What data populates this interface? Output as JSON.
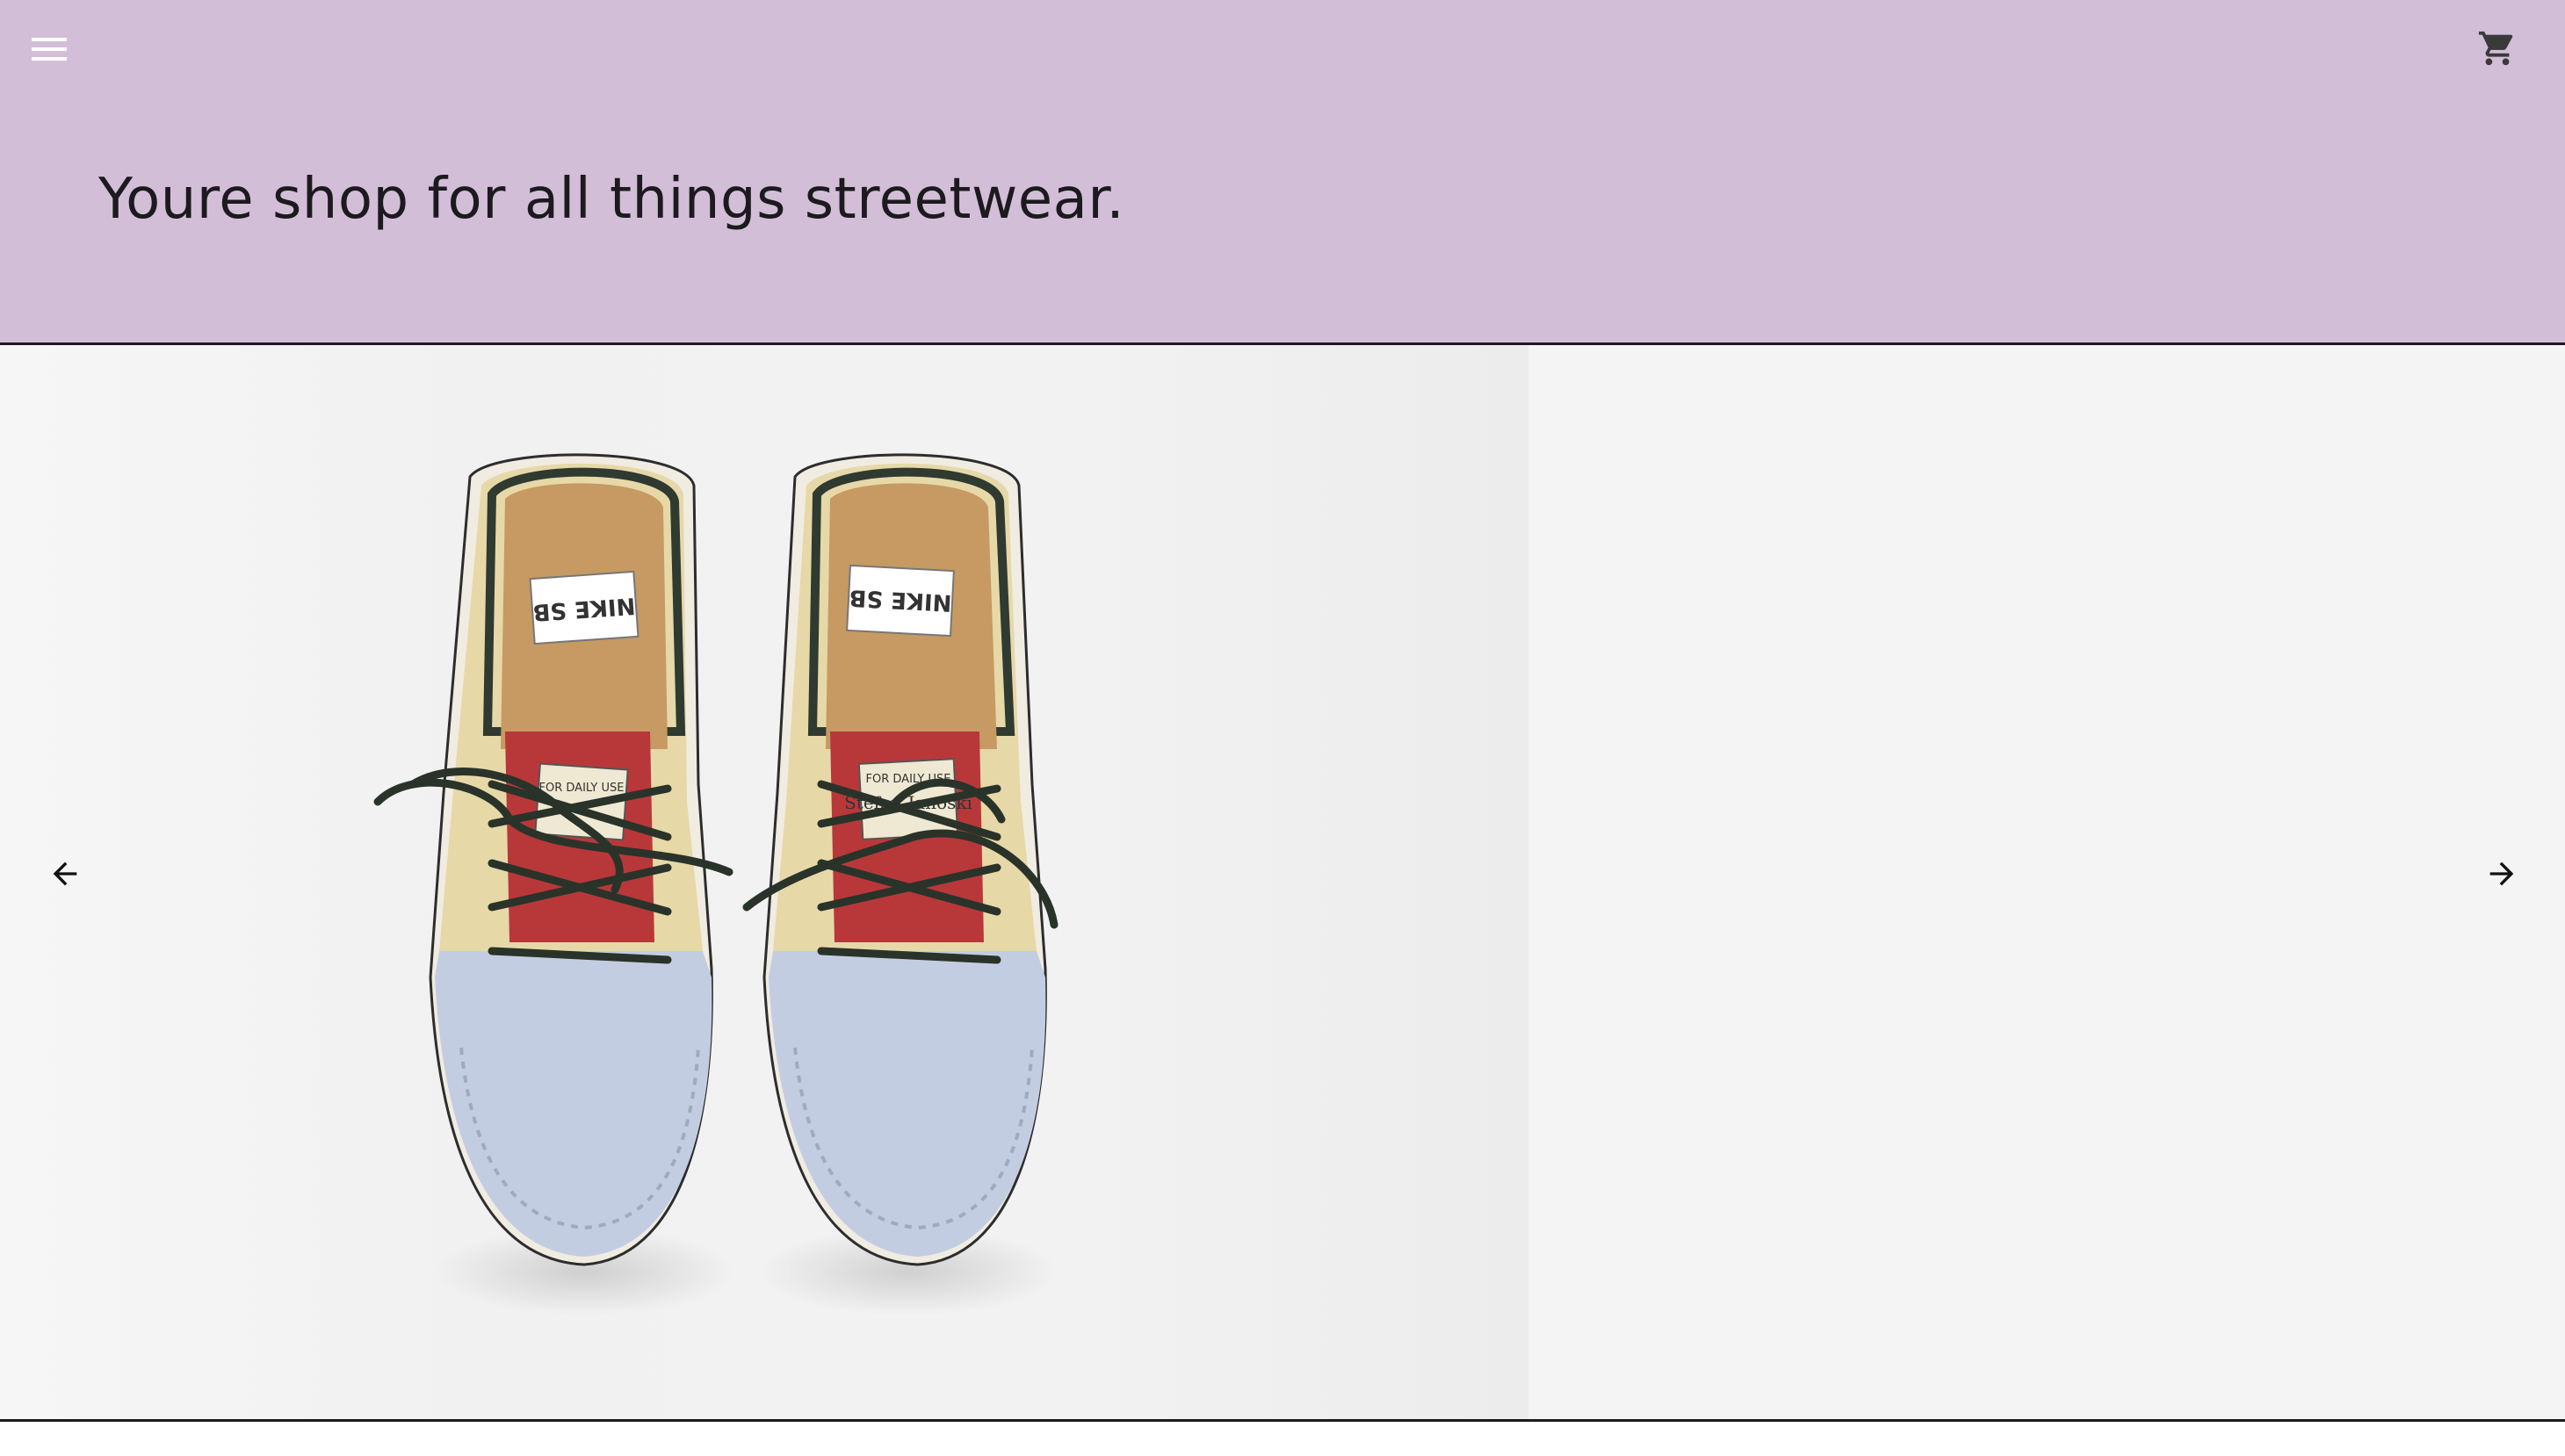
{
  "header": {
    "background": "#d3bed8",
    "menu_icon": "hamburger-menu-icon",
    "cart_icon": "shopping-cart-icon",
    "tagline": "Youre shop for all things streetwear."
  },
  "carousel": {
    "prev_icon": "arrow-left-icon",
    "next_icon": "arrow-right-icon",
    "slide": {
      "image": "sneakers-product-photo",
      "insole_label_left": "NIKE SB",
      "insole_label_right": "NIKE SB",
      "tongue_label_top": "FOR DAILY USE",
      "tongue_label_name": "Stefan Janoski"
    }
  },
  "colors": {
    "accent": "#d3bed8",
    "text": "#1c1a1e",
    "slide_bg": "#f4f4f4"
  }
}
